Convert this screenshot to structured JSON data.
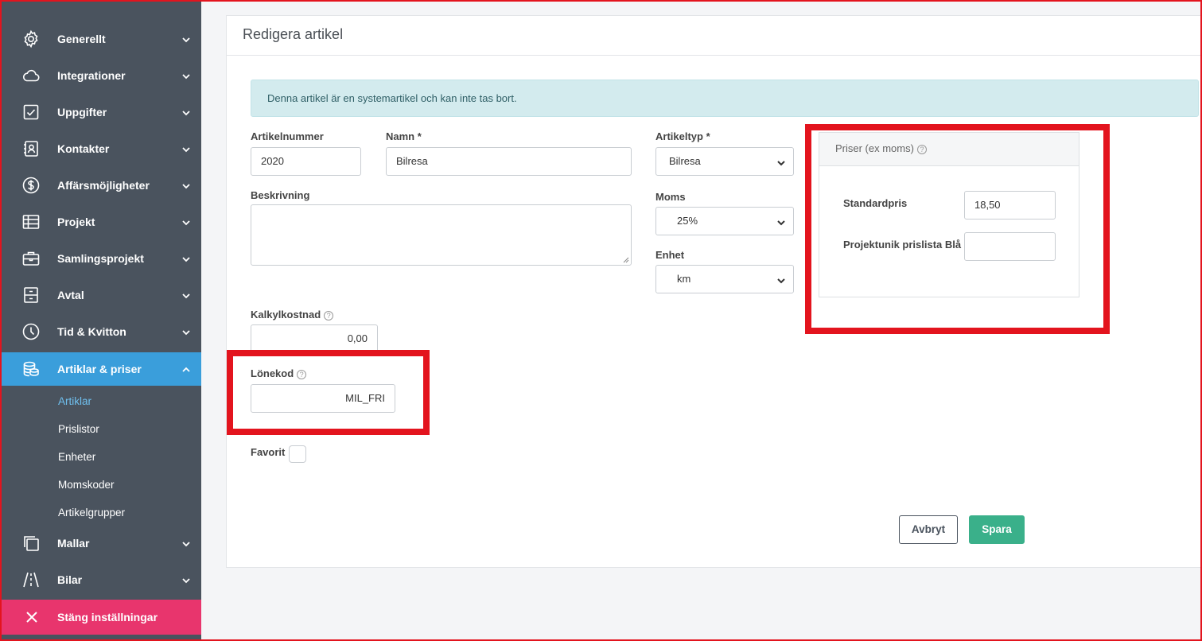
{
  "sidebar": {
    "items": [
      {
        "label": "Generellt",
        "icon": "gear-icon"
      },
      {
        "label": "Integrationer",
        "icon": "cloud-icon"
      },
      {
        "label": "Uppgifter",
        "icon": "checkbox-icon"
      },
      {
        "label": "Kontakter",
        "icon": "contact-book-icon"
      },
      {
        "label": "Affärsmöjligheter",
        "icon": "dollar-circle-icon"
      },
      {
        "label": "Projekt",
        "icon": "table-icon"
      },
      {
        "label": "Samlingsprojekt",
        "icon": "briefcase-icon"
      },
      {
        "label": "Avtal",
        "icon": "cabinet-icon"
      },
      {
        "label": "Tid & Kvitton",
        "icon": "clock-icon"
      },
      {
        "label": "Artiklar & priser",
        "icon": "coins-icon"
      },
      {
        "label": "Mallar",
        "icon": "copy-icon"
      },
      {
        "label": "Bilar",
        "icon": "road-icon"
      }
    ],
    "subitems": [
      "Artiklar",
      "Prislistor",
      "Enheter",
      "Momskoder",
      "Artikelgrupper"
    ],
    "close_label": "Stäng inställningar"
  },
  "card": {
    "title": "Redigera artikel",
    "alert": "Denna artikel är en systemartikel och kan inte tas bort."
  },
  "form": {
    "artikelnummer_label": "Artikelnummer",
    "artikelnummer_value": "2020",
    "namn_label": "Namn *",
    "namn_value": "Bilresa",
    "beskrivning_label": "Beskrivning",
    "artikeltyp_label": "Artikeltyp *",
    "artikeltyp_value": "Bilresa",
    "moms_label": "Moms",
    "moms_value": "25%",
    "enhet_label": "Enhet",
    "enhet_value": "km",
    "kalkylkostnad_label": "Kalkylkostnad",
    "kalkylkostnad_value": "0,00",
    "lonekod_label": "Lönekod",
    "lonekod_value": "MIL_FRI",
    "favorit_label": "Favorit",
    "help_glyph": "?"
  },
  "prices": {
    "header": "Priser (ex moms)",
    "standardpris_label": "Standardpris",
    "standardpris_value": "18,50",
    "prislista_label": "Projektunik prislista Blå",
    "prislista_value": ""
  },
  "buttons": {
    "cancel": "Avbryt",
    "save": "Spara"
  },
  "colors": {
    "sidebar_bg": "#4a535e",
    "active_bg": "#3a9edb",
    "close_bg": "#e8356d",
    "save_bg": "#3ab08a",
    "highlight_red": "#e3141e"
  }
}
